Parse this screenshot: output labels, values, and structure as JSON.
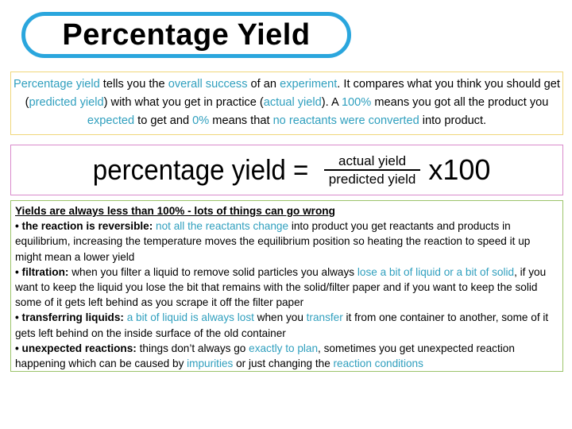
{
  "title": "Percentage Yield",
  "colors": {
    "title_border": "#2aa6dd",
    "highlight": "#2f9fbe",
    "intro_border": "#f0d77a",
    "formula_border": "#d98acb",
    "reasons_border": "#9cc46a"
  },
  "intro": {
    "segments": [
      {
        "t": "Percentage yield",
        "hl": true
      },
      {
        "t": " tells you the "
      },
      {
        "t": "overall success",
        "hl": true
      },
      {
        "t": " of an "
      },
      {
        "t": "experiment",
        "hl": true
      },
      {
        "t": ". It compares what you think you should get ("
      },
      {
        "t": "predicted yield",
        "hl": true
      },
      {
        "t": ") with what you get in practice ("
      },
      {
        "t": "actual yield",
        "hl": true
      },
      {
        "t": "). A "
      },
      {
        "t": "100%",
        "hl": true
      },
      {
        "t": " means you got all the product you "
      },
      {
        "t": "expected",
        "hl": true
      },
      {
        "t": " to get and "
      },
      {
        "t": "0%",
        "hl": true
      },
      {
        "t": " means that "
      },
      {
        "t": "no reactants were converted",
        "hl": true
      },
      {
        "t": " into product."
      }
    ]
  },
  "formula": {
    "lhs": "percentage yield =",
    "numerator": "actual yield",
    "denominator": "predicted yield",
    "multiplier": "x100"
  },
  "reasons": {
    "heading": "Yields are always less than 100% - lots of things can go wrong",
    "items": [
      {
        "label": "• the reaction is reversible:",
        "segments": [
          {
            "t": " "
          },
          {
            "t": "not all the reactants change",
            "hl": true
          },
          {
            "t": " into product you get reactants and products in equilibrium, increasing the temperature moves the equilibrium position so heating the reaction to speed it up might mean a lower yield"
          }
        ]
      },
      {
        "label": "• filtration:",
        "segments": [
          {
            "t": " when you filter a liquid to remove solid particles you always "
          },
          {
            "t": "lose a bit of liquid or a bit of solid",
            "hl": true
          },
          {
            "t": ", if you want to keep the liquid you lose the bit that remains with the solid/filter paper and if you want to keep the solid some of it gets left behind as you scrape it off the filter paper"
          }
        ]
      },
      {
        "label": "• transferring liquids:",
        "segments": [
          {
            "t": " "
          },
          {
            "t": "a bit of liquid is always lost",
            "hl": true
          },
          {
            "t": " when you "
          },
          {
            "t": "transfer",
            "hl": true
          },
          {
            "t": " it from one container to another, some of it gets left behind on the inside surface of the old container"
          }
        ]
      },
      {
        "label": "• unexpected reactions:",
        "segments": [
          {
            "t": " things don’t always go "
          },
          {
            "t": "exactly to plan",
            "hl": true
          },
          {
            "t": ", sometimes you get unexpected reaction happening which can be caused by "
          },
          {
            "t": "impurities",
            "hl": true
          },
          {
            "t": " or just changing the "
          },
          {
            "t": "reaction conditions",
            "hl": true
          }
        ]
      }
    ]
  }
}
